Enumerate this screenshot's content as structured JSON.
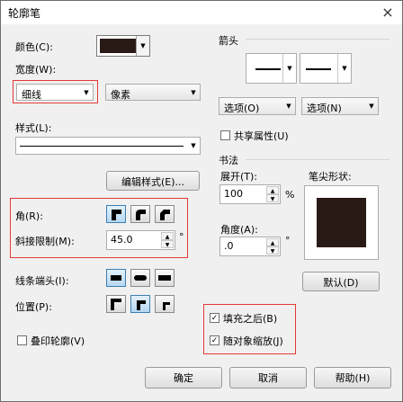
{
  "window": {
    "title": "轮廓笔",
    "close_glyph": "×"
  },
  "left": {
    "color_label": "颜色(C):",
    "color_value": "#2a1a16",
    "width_label": "宽度(W):",
    "width_value": "细线",
    "unit_value": "像素",
    "style_label": "样式(L):",
    "edit_style_button": "编辑样式(E)...",
    "corner_label": "角(R):",
    "miter_label": "斜接限制(M):",
    "miter_value": "45.0",
    "miter_unit": "°",
    "linecap_label": "线条端头(I):",
    "position_label": "位置(P):",
    "overprint_label": "叠印轮廓(V)",
    "overprint_checked": false
  },
  "arrows": {
    "header": "箭头",
    "options_left": "选项(O)",
    "options_right": "选项(N)",
    "share_label": "共享属性(U)",
    "share_checked": false
  },
  "calligraphy": {
    "header": "书法",
    "stretch_label": "展开(T):",
    "stretch_value": "100",
    "stretch_unit": "%",
    "angle_label": "角度(A):",
    "angle_value": ".0",
    "angle_unit": "°",
    "nib_label": "笔尖形状:",
    "default_button": "默认(D)"
  },
  "options": {
    "behind_fill_label": "填充之后(B)",
    "behind_fill_checked": true,
    "scale_label": "随对象缩放(J)",
    "scale_checked": true
  },
  "footer": {
    "ok": "确定",
    "cancel": "取消",
    "help": "帮助(H)"
  },
  "glyphs": {
    "down": "▼",
    "up": "▲",
    "check": "✓"
  },
  "colors": {
    "highlight_red": "#e53935",
    "nib_fill": "#2a1a16",
    "selected_blue": "#b6d8f2"
  }
}
